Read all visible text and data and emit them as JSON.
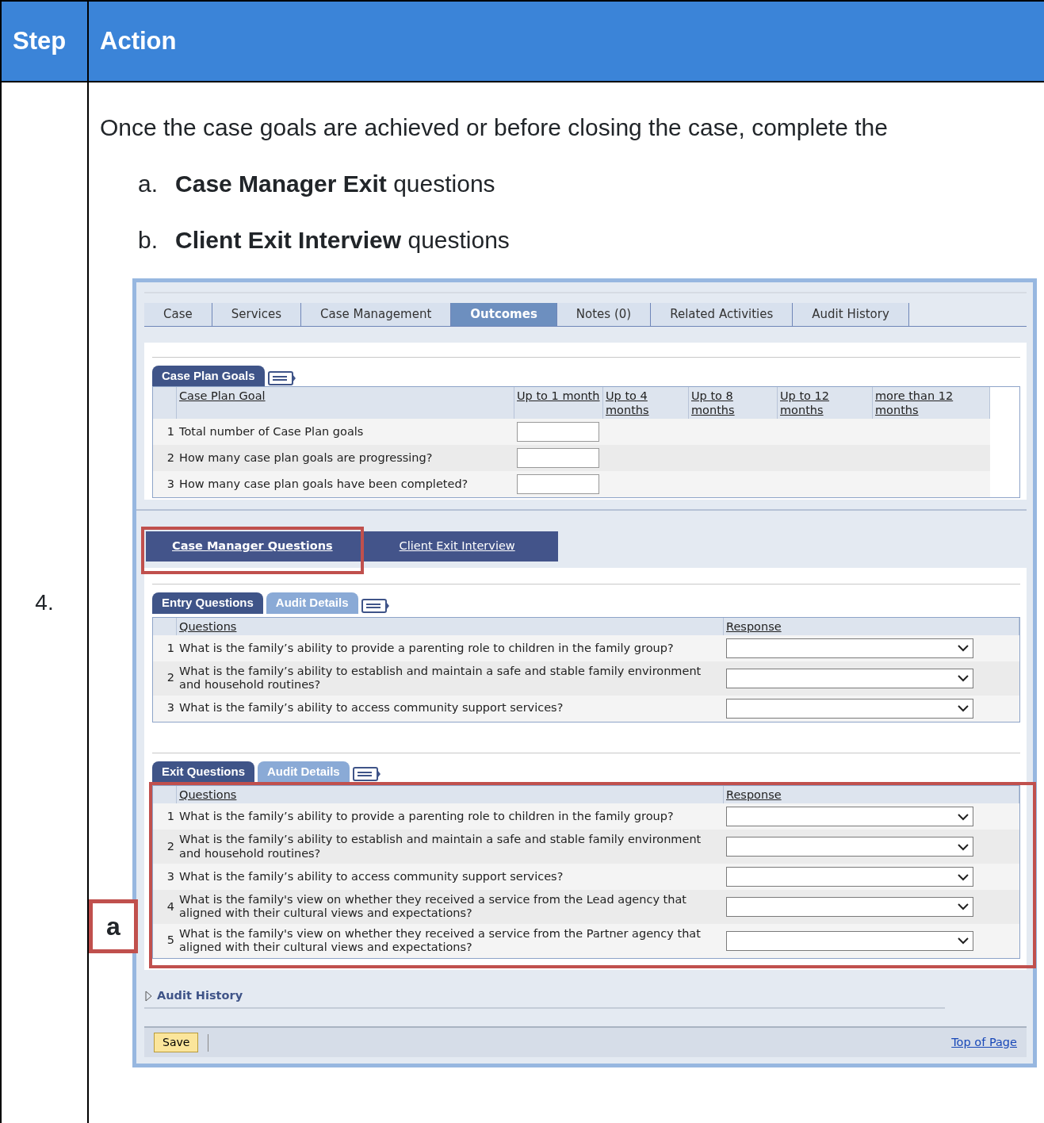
{
  "table": {
    "columns": [
      "Step",
      "Action"
    ]
  },
  "step": "4.",
  "intro": "Once the case goals are achieved or before closing the case, complete the",
  "steps_list": [
    {
      "marker": "a.",
      "text": "**Case Manager Exit** questions"
    },
    {
      "marker": "b.",
      "text": "**Client Exit Interview** questions"
    }
  ],
  "callout": "a",
  "screen": {
    "tabs": [
      {
        "label": "Case",
        "selected": false
      },
      {
        "label": "Services",
        "selected": false
      },
      {
        "label": "Case Management",
        "selected": false
      },
      {
        "label": "Outcomes",
        "selected": true
      },
      {
        "label": "Notes (0)",
        "selected": false
      },
      {
        "label": "Related Activities",
        "selected": false
      },
      {
        "label": "Audit History",
        "selected": false
      }
    ],
    "goals": {
      "tab": "Case Plan Goals",
      "columns": [
        "Case Plan Goal",
        "Up to 1 month",
        "Up to 4 months",
        "Up to 8 months",
        "Up to 12 months",
        "more than 12 months"
      ],
      "rows": [
        {
          "num": "1",
          "text": "Total number of Case Plan goals"
        },
        {
          "num": "2",
          "text": "How many case plan goals are progressing?"
        },
        {
          "num": "3",
          "text": "How many case plan goals have been completed?"
        }
      ]
    },
    "subtabs": [
      {
        "label": "Case Manager Questions",
        "selected": true,
        "highlighted": true
      },
      {
        "label": "Client Exit Interview",
        "selected": false,
        "highlighted": false
      }
    ],
    "sections": [
      {
        "tabs": [
          {
            "label": "Entry Questions",
            "selected": true
          },
          {
            "label": "Audit Details",
            "selected": false
          }
        ],
        "columns": [
          "Questions",
          "Response"
        ],
        "highlighted": false,
        "rows": [
          {
            "num": "1",
            "text": "What is the family’s ability to provide a parenting role to children in the family group?"
          },
          {
            "num": "2",
            "text": "What is the family’s ability to establish and maintain a safe and stable family environment and household routines?"
          },
          {
            "num": "3",
            "text": "What is the family’s ability to access community support services?"
          }
        ]
      },
      {
        "tabs": [
          {
            "label": "Exit Questions",
            "selected": true
          },
          {
            "label": "Audit Details",
            "selected": false
          }
        ],
        "columns": [
          "Questions",
          "Response"
        ],
        "highlighted": true,
        "rows": [
          {
            "num": "1",
            "text": "What is the family’s ability to provide a parenting role to children in the family group?"
          },
          {
            "num": "2",
            "text": "What is the family’s ability to establish and maintain a safe and stable family environment and household routines?"
          },
          {
            "num": "3",
            "text": "What is the family’s ability to access community support services?"
          },
          {
            "num": "4",
            "text": "What is the family's view on whether they received a service from the Lead agency that aligned with their cultural views and expectations?"
          },
          {
            "num": "5",
            "text": "What is the family's view on whether they received a service from the Partner agency that aligned with their cultural views and expectations?"
          }
        ]
      }
    ],
    "audit_history": {
      "label": "Audit History",
      "expanded": false
    },
    "save": "Save",
    "top_link": "Top of Page"
  }
}
